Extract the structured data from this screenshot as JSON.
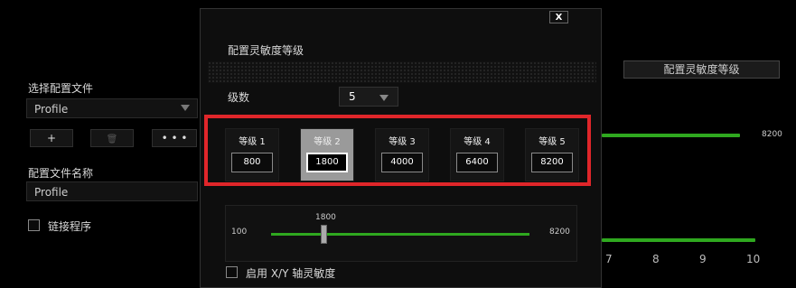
{
  "left": {
    "profile_label": "选择配置文件",
    "profile_value": "Profile",
    "add_label": "+",
    "delete_label": "🗑",
    "more_label": "• • •",
    "name_label": "配置文件名称",
    "name_value": "Profile",
    "link_label": "链接程序"
  },
  "background": {
    "button_label": "配置灵敏度等级",
    "value_top": "8200",
    "axis_numbers": [
      "7",
      "8",
      "9",
      "10"
    ]
  },
  "modal": {
    "title": "配置灵敏度等级",
    "close_label": "X",
    "levels_label": "级数",
    "levels_value": "5",
    "levels": [
      {
        "title": "等级 1",
        "value": "800"
      },
      {
        "title": "等级 2",
        "value": "1800"
      },
      {
        "title": "等级 3",
        "value": "4000"
      },
      {
        "title": "等级 4",
        "value": "6400"
      },
      {
        "title": "等级 5",
        "value": "8200"
      }
    ],
    "slider": {
      "min": "100",
      "max": "8200",
      "current": "1800"
    },
    "xy_label": "启用 X/Y 轴灵敏度"
  },
  "colors": {
    "accent_green": "#2fa81f",
    "highlight_red": "#e0262a"
  }
}
